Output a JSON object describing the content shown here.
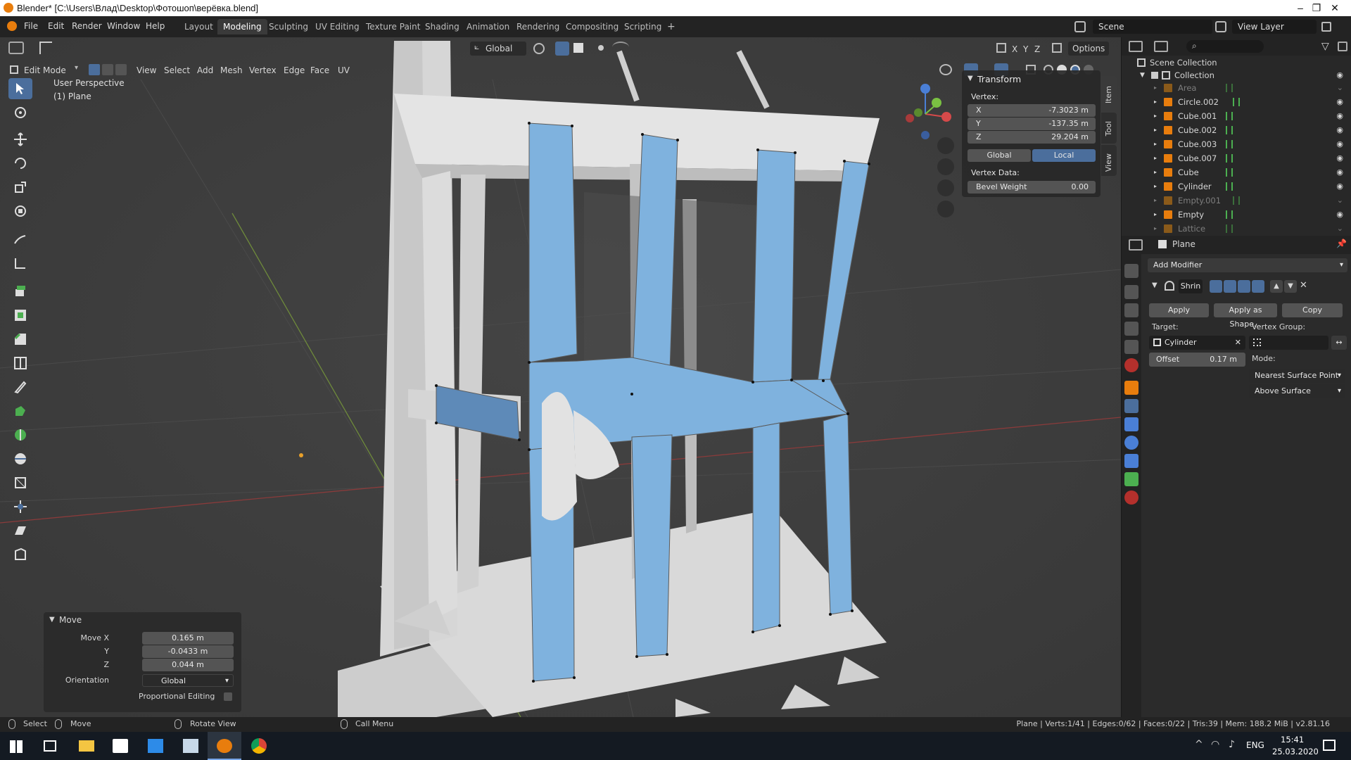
{
  "window": {
    "title": "Blender* [C:\\Users\\Влад\\Desktop\\Фотошоп\\верёвка.blend]",
    "controls": [
      "–",
      "❐",
      "✕"
    ]
  },
  "menubar": {
    "menus": [
      "File",
      "Edit",
      "Render",
      "Window",
      "Help"
    ],
    "workspaces": [
      "Layout",
      "Modeling",
      "Sculpting",
      "UV Editing",
      "Texture Paint",
      "Shading",
      "Animation",
      "Rendering",
      "Compositing",
      "Scripting"
    ],
    "active_workspace": "Modeling",
    "add_tab": "+",
    "scene": "Scene",
    "view_layer": "View Layer"
  },
  "viewport_header": {
    "mode": "Edit Mode",
    "menus": [
      "View",
      "Select",
      "Add",
      "Mesh",
      "Vertex",
      "Edge",
      "Face",
      "UV"
    ],
    "orientation": "Global",
    "axes": [
      "X",
      "Y",
      "Z"
    ],
    "options": "Options"
  },
  "viewport": {
    "perspective": "User Perspective",
    "object": "(1) Plane",
    "side_tabs": [
      "Item",
      "Tool",
      "View"
    ]
  },
  "npanel": {
    "section": "Transform",
    "vertex_label": "Vertex:",
    "x_label": "X",
    "x_value": "-7.3023 m",
    "y_label": "Y",
    "y_value": "-137.35 m",
    "z_label": "Z",
    "z_value": "29.204 m",
    "global": "Global",
    "local": "Local",
    "vertex_data": "Vertex Data:",
    "bevel_label": "Bevel Weight",
    "bevel_value": "0.00"
  },
  "operator_panel": {
    "title": "Move",
    "move_x_label": "Move X",
    "move_x": "0.165 m",
    "y_label": "Y",
    "y": "-0.0433 m",
    "z_label": "Z",
    "z": "0.044 m",
    "orientation_label": "Orientation",
    "orientation": "Global",
    "proportional": "Proportional Editing"
  },
  "outliner": {
    "root": "Scene Collection",
    "collection": "Collection",
    "items": [
      {
        "name": "Area",
        "dim": true
      },
      {
        "name": "Circle.002",
        "dim": false
      },
      {
        "name": "Cube.001",
        "dim": false
      },
      {
        "name": "Cube.002",
        "dim": false
      },
      {
        "name": "Cube.003",
        "dim": false
      },
      {
        "name": "Cube.007",
        "dim": false
      },
      {
        "name": "Cube",
        "dim": false
      },
      {
        "name": "Cylinder",
        "dim": false
      },
      {
        "name": "Empty.001",
        "dim": true
      },
      {
        "name": "Empty",
        "dim": false
      },
      {
        "name": "Lattice",
        "dim": true
      }
    ]
  },
  "properties": {
    "object": "Plane",
    "add_modifier": "Add Modifier",
    "modifier_name": "Shrin",
    "apply": "Apply",
    "apply_shape": "Apply as Shape...",
    "copy": "Copy",
    "target_label": "Target:",
    "target": "Cylinder",
    "vertex_group_label": "Vertex Group:",
    "offset_label": "Offset",
    "offset": "0.17 m",
    "mode_label": "Mode:",
    "mode": "Nearest Surface Point",
    "mode2": "Above Surface"
  },
  "statusbar": {
    "select": "Select",
    "move": "Move",
    "rotate": "Rotate View",
    "call_menu": "Call Menu",
    "stats": "Plane | Verts:1/41 | Edges:0/62 | Faces:0/22 | Tris:39 | Mem: 188.2 MiB | v2.81.16"
  },
  "taskbar": {
    "lang": "ENG",
    "time": "15:41",
    "date": "25.03.2020"
  },
  "colors": {
    "accent": "#4b6e9c",
    "face_select": "#7fb2de",
    "orange": "#e87d0d"
  }
}
